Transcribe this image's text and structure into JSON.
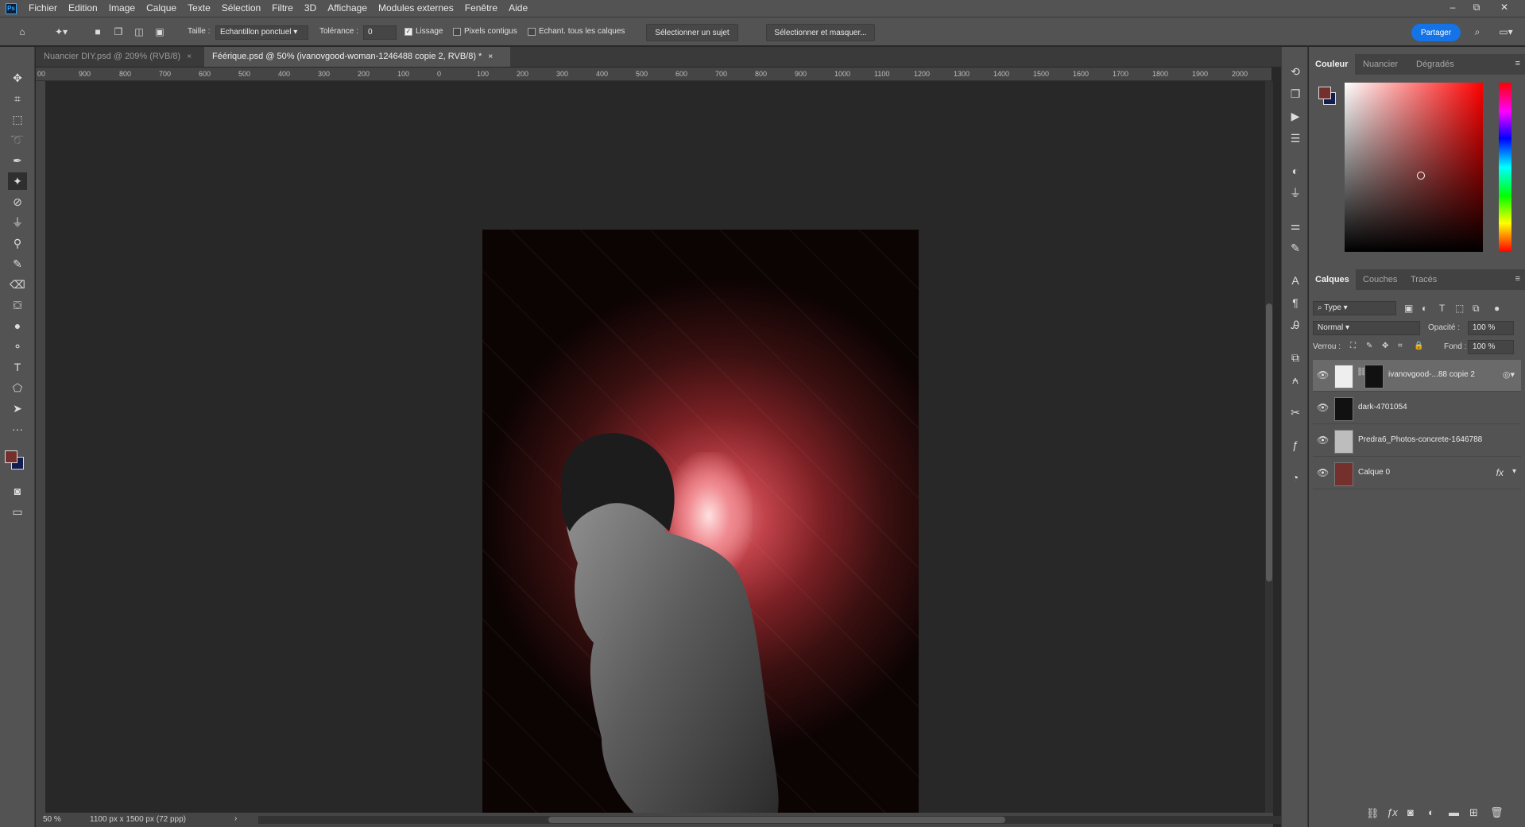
{
  "app": {
    "logo": "Ps"
  },
  "menu": [
    "Fichier",
    "Edition",
    "Image",
    "Calque",
    "Texte",
    "Sélection",
    "Filtre",
    "3D",
    "Affichage",
    "Modules externes",
    "Fenêtre",
    "Aide"
  ],
  "window_controls": {
    "minimize": "–",
    "restore": "⧉",
    "close": "✕"
  },
  "options": {
    "taille_label": "Taille :",
    "taille_value": "Echantillon ponctuel",
    "tolerance_label": "Tolérance :",
    "tolerance_value": "0",
    "lissage_label": "Lissage",
    "lissage_checked": true,
    "contigus_label": "Pixels contigus",
    "contigus_checked": false,
    "echant_label": "Echant. tous les calques",
    "echant_checked": false,
    "select_subject": "Sélectionner un sujet",
    "select_mask": "Sélectionner et masquer...",
    "share": "Partager"
  },
  "tabs": [
    {
      "label": "Nuancier DIY.psd @ 209% (RVB/8)",
      "close": "×",
      "active": false
    },
    {
      "label": "Féérique.psd @ 50% (ivanovgood-woman-1246488 copie 2, RVB/8) *",
      "close": "×",
      "active": true
    }
  ],
  "ruler_h": [
    "00",
    "900",
    "800",
    "700",
    "600",
    "500",
    "400",
    "300",
    "200",
    "100",
    "0",
    "100",
    "200",
    "300",
    "400",
    "500",
    "600",
    "700",
    "800",
    "900",
    "1000",
    "1100",
    "1200",
    "1300",
    "1400",
    "1500",
    "1600",
    "1700",
    "1800",
    "1900",
    "2000"
  ],
  "status": {
    "zoom": "50 %",
    "doc_size": "1100 px x 1500 px (72 ppp)"
  },
  "color_panel": {
    "tabs": [
      "Couleur",
      "Nuancier",
      "Dégradés"
    ],
    "fg": "#74302d",
    "bg": "#121d50"
  },
  "layers_panel": {
    "tabs": [
      "Calques",
      "Couches",
      "Tracés"
    ],
    "filter": "Type",
    "blend_mode": "Normal",
    "opacity_label": "Opacité :",
    "opacity": "100 %",
    "lock_label": "Verrou :",
    "fill_label": "Fond :",
    "fill": "100 %",
    "layers": [
      {
        "name": "ivanovgood-...88 copie 2",
        "visible": true,
        "selected": true,
        "has_mask": true,
        "fx": false
      },
      {
        "name": "dark-4701054",
        "visible": true,
        "selected": false,
        "has_mask": false,
        "fx": false
      },
      {
        "name": "Predra6_Photos-concrete-1646788",
        "visible": true,
        "selected": false,
        "has_mask": false,
        "fx": false
      },
      {
        "name": "Calque 0",
        "visible": true,
        "selected": false,
        "has_mask": false,
        "fx": true,
        "fx_label": "fx"
      }
    ]
  }
}
